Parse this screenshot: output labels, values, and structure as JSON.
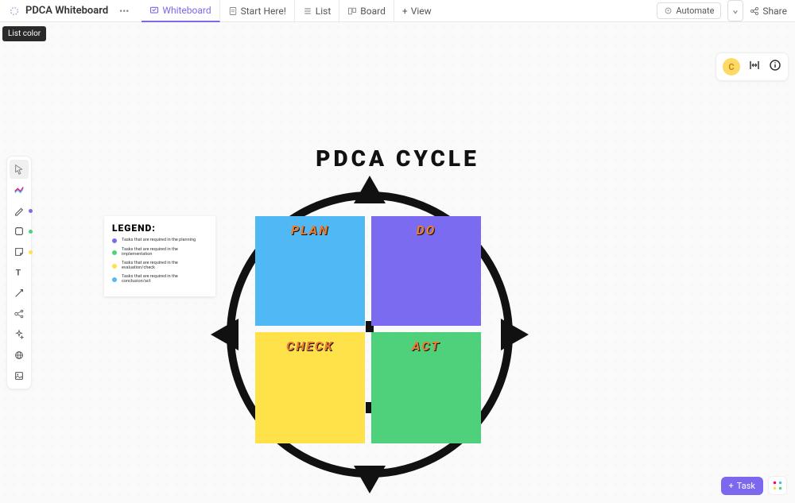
{
  "header": {
    "title": "PDCA Whiteboard",
    "tabs": [
      {
        "label": "Whiteboard",
        "active": true
      },
      {
        "label": "Start Here!"
      },
      {
        "label": "List"
      },
      {
        "label": "Board"
      },
      {
        "label": "View"
      }
    ],
    "automate": "Automate",
    "share": "Share"
  },
  "tooltip": "List color",
  "avatar_initial": "C",
  "toolbar": {
    "tools": [
      "pointer",
      "diagram",
      "pen",
      "shape",
      "sticky",
      "text",
      "connector",
      "mindmap",
      "ai",
      "web",
      "image"
    ],
    "dots": [
      {
        "index": 2,
        "color": "#7a6bf0"
      },
      {
        "index": 3,
        "color": "#4fd17b"
      },
      {
        "index": 4,
        "color": "#ffe24a"
      }
    ]
  },
  "whiteboard": {
    "title": "PDCA CYCLE",
    "quadrants": {
      "plan": "PLAN",
      "do": "DO",
      "check": "CHECK",
      "act": "ACT"
    }
  },
  "legend": {
    "title": "LEGEND:",
    "items": [
      {
        "color": "#7a6bf0",
        "text": "Tasks that are required in the planning"
      },
      {
        "color": "#4fd17b",
        "text": "Tasks that are required in the implementation"
      },
      {
        "color": "#ffe24a",
        "text": "Tasks that are required in the evaluation/check"
      },
      {
        "color": "#4fb8f5",
        "text": "Tasks that are required in the conclusion/act"
      }
    ]
  },
  "task_button": "Task"
}
